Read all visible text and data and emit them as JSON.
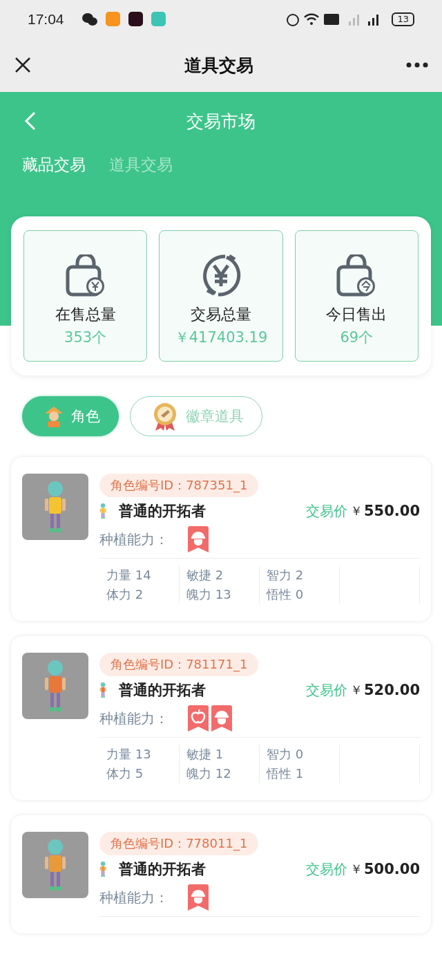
{
  "status_bar": {
    "time": "17:04",
    "battery": "13"
  },
  "nav_bar": {
    "title": "道具交易"
  },
  "header": {
    "title": "交易市场",
    "tabs": [
      {
        "label": "藏品交易",
        "selected": true
      },
      {
        "label": "道具交易",
        "selected": false
      }
    ]
  },
  "stats": [
    {
      "kind": "bag-yen",
      "label": "在售总量",
      "value": "353个"
    },
    {
      "kind": "exchange",
      "label": "交易总量",
      "value": "￥417403.19"
    },
    {
      "kind": "bag-today",
      "label": "今日售出",
      "value": "69个"
    }
  ],
  "categories": [
    {
      "kind": "character",
      "label": "角色",
      "selected": true
    },
    {
      "kind": "medal",
      "label": "徽章道具",
      "selected": false
    }
  ],
  "listings": [
    {
      "id": "角色编号ID：787351_1",
      "name": "普通的开拓者",
      "price_label": "交易价",
      "currency": "￥",
      "price": "550.00",
      "ability_label": "种植能力：",
      "abilities": [
        {
          "kind": "hat"
        }
      ],
      "color": "#f4c430",
      "stats": [
        [
          "力量 14",
          "体力 2"
        ],
        [
          "敏捷 2",
          "魄力 13"
        ],
        [
          "智力 2",
          "悟性 0"
        ]
      ]
    },
    {
      "id": "角色编号ID：781171_1",
      "name": "普通的开拓者",
      "price_label": "交易价",
      "currency": "￥",
      "price": "520.00",
      "ability_label": "种植能力：",
      "abilities": [
        {
          "kind": "apple"
        },
        {
          "kind": "hat"
        }
      ],
      "color": "#e8773a",
      "stats": [
        [
          "力量 13",
          "体力 5"
        ],
        [
          "敏捷 1",
          "魄力 12"
        ],
        [
          "智力 0",
          "悟性 1"
        ]
      ]
    },
    {
      "id": "角色编号ID：778011_1",
      "name": "普通的开拓者",
      "price_label": "交易价",
      "currency": "￥",
      "price": "500.00",
      "ability_label": "种植能力：",
      "abilities": [
        {
          "kind": "hat"
        }
      ],
      "color": "#e89a3a"
    }
  ]
}
